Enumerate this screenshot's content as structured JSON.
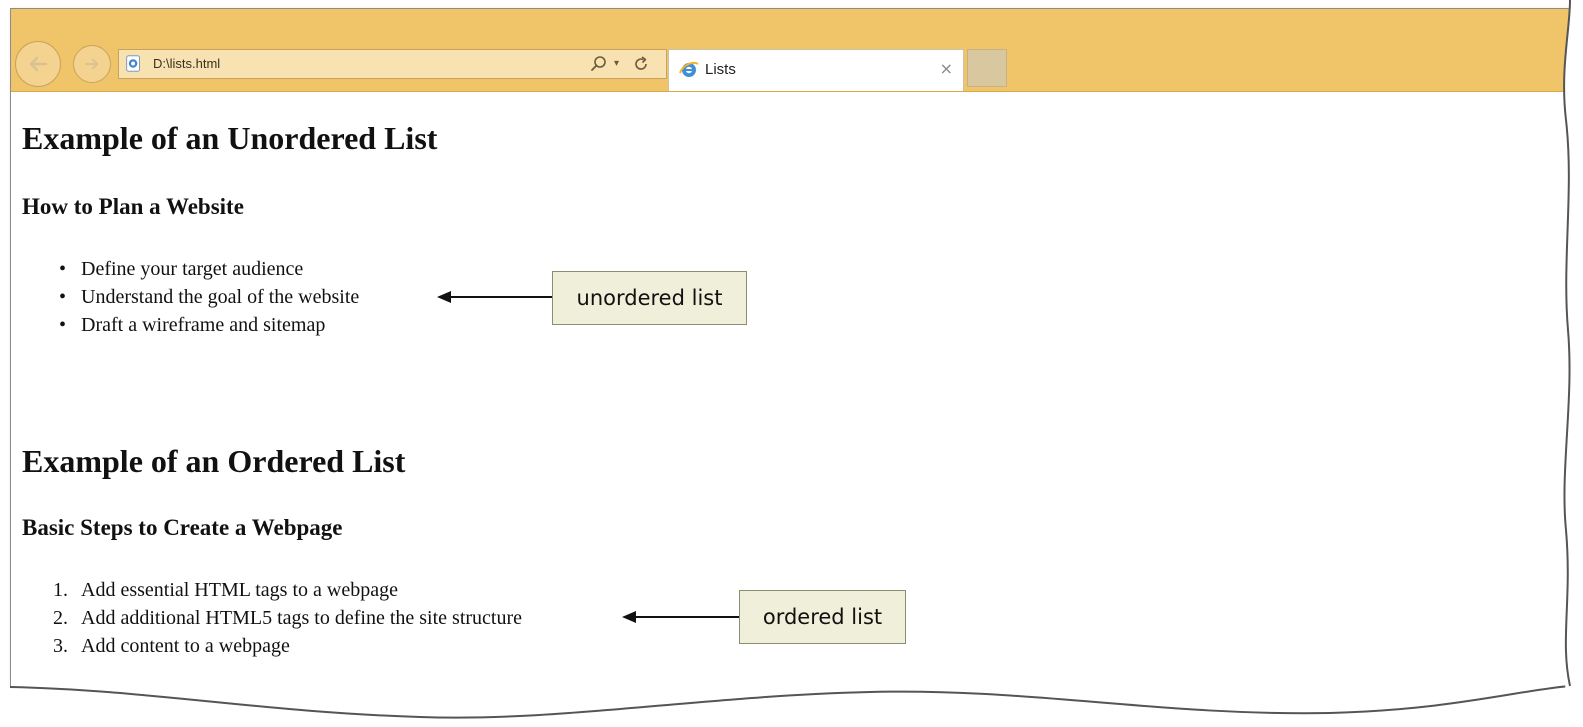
{
  "browser": {
    "address_url": "D:\\lists.html",
    "tab_title": "Lists",
    "tab_close_glyph": "×",
    "dropdown_glyph": "▾",
    "chrome_color": "#f0c469",
    "icons": {
      "back": "back-arrow-icon",
      "forward": "forward-arrow-icon",
      "page": "ie-page-icon",
      "search": "search-icon",
      "refresh": "refresh-icon",
      "tab": "ie-logo-icon",
      "close": "close-icon"
    }
  },
  "page": {
    "unordered_section": {
      "heading": "Example of an Unordered List",
      "subheading": "How to Plan a Website",
      "items": [
        "Define your target audience",
        "Understand the goal of the website",
        "Draft a wireframe and sitemap"
      ],
      "bullet": "•"
    },
    "ordered_section": {
      "heading": "Example of an Ordered List",
      "subheading": "Basic Steps to Create a Webpage",
      "items": [
        {
          "marker": "1.",
          "text": "Add essential HTML tags to a webpage"
        },
        {
          "marker": "2.",
          "text": "Add additional HTML5 tags to define the site structure"
        },
        {
          "marker": "3.",
          "text": "Add content to a webpage"
        }
      ]
    }
  },
  "callouts": {
    "unordered_label": "unordered list",
    "ordered_label": "ordered list",
    "box_color": "#efefda"
  }
}
